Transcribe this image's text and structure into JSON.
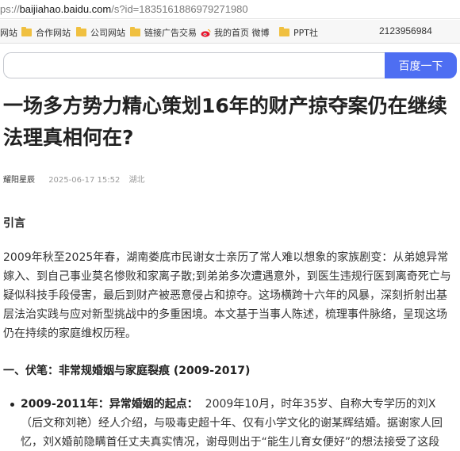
{
  "browser": {
    "url_prefix": "ps://",
    "url_host": "baijiahao.baidu.com",
    "url_path": "/s?id=1835161886979271980"
  },
  "bookmarks": {
    "items": [
      {
        "label": "网站"
      },
      {
        "label": "合作网站"
      },
      {
        "label": "公司网站"
      },
      {
        "label": "链接广告交易"
      },
      {
        "label": "我的首页 微博"
      },
      {
        "label": "PPT社"
      }
    ],
    "number": "2123956984"
  },
  "search": {
    "button_label": "百度一下"
  },
  "article": {
    "title": "一场多方势力精心策划16年的财产掠夺案仍在继续 法理真相何在?",
    "author": "耀阳星辰",
    "time": "2025-06-17 15:52",
    "location": "湖北",
    "intro_heading": "引言",
    "intro_paragraph": "2009年秋至2025年春，湖南娄底市民谢女士亲历了常人难以想象的家族剧变：从弟媳异常嫁入、到自己事业莫名惨败和家离子散;到弟弟多次遭遇意外，到医生违规行医到离奇死亡与疑似科技手段侵害，最后到财产被恶意侵占和掠夺。这场横跨十六年的风暴，深刻折射出基层法治实践与应对新型挑战中的多重困境。本文基于当事人陈述，梳理事件脉络，呈现这场仍在持续的家庭维权历程。",
    "section1_heading": "一、伏笔：非常规婚姻与家庭裂痕 (2009-2017)",
    "bullet1_label": "2009-2011年：异常婚姻的起点：",
    "bullet1_text": "2009年10月，时年35岁、自称大专学历的刘X（后文称刘艳）经人介绍，与吸毒史超十年、仅有小学文化的谢某辉结婚。据谢家人回忆，刘X婚前隐瞒首任丈夫真实情况，谢母则出于“能生儿育女便好”的想法接受了这段"
  }
}
